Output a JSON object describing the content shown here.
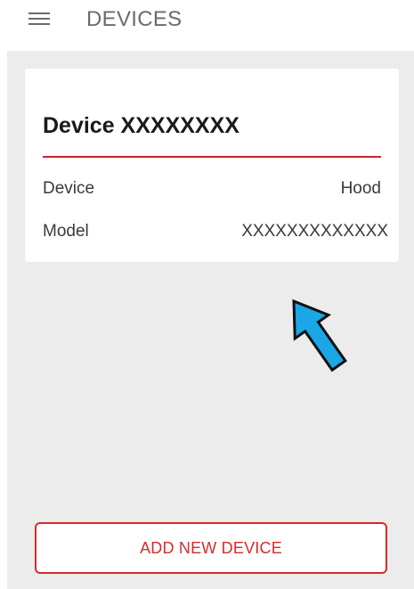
{
  "appbar": {
    "title": "DEVICES",
    "menu_icon": "hamburger-menu-icon"
  },
  "device_card": {
    "name": "Device XXXXXXXX",
    "rows": [
      {
        "label": "Device",
        "value": "Hood"
      },
      {
        "label": "Model",
        "value": "XXXXXXXXXXXXX"
      }
    ]
  },
  "annotation": {
    "icon": "pointer-arrow-icon",
    "color": "#1ba7e6"
  },
  "actions": {
    "add_label": "ADD NEW DEVICE"
  },
  "colors": {
    "accent": "#d52b2b",
    "divider": "#c8232c",
    "background": "#ececec",
    "header_text": "#6b6b6b"
  }
}
